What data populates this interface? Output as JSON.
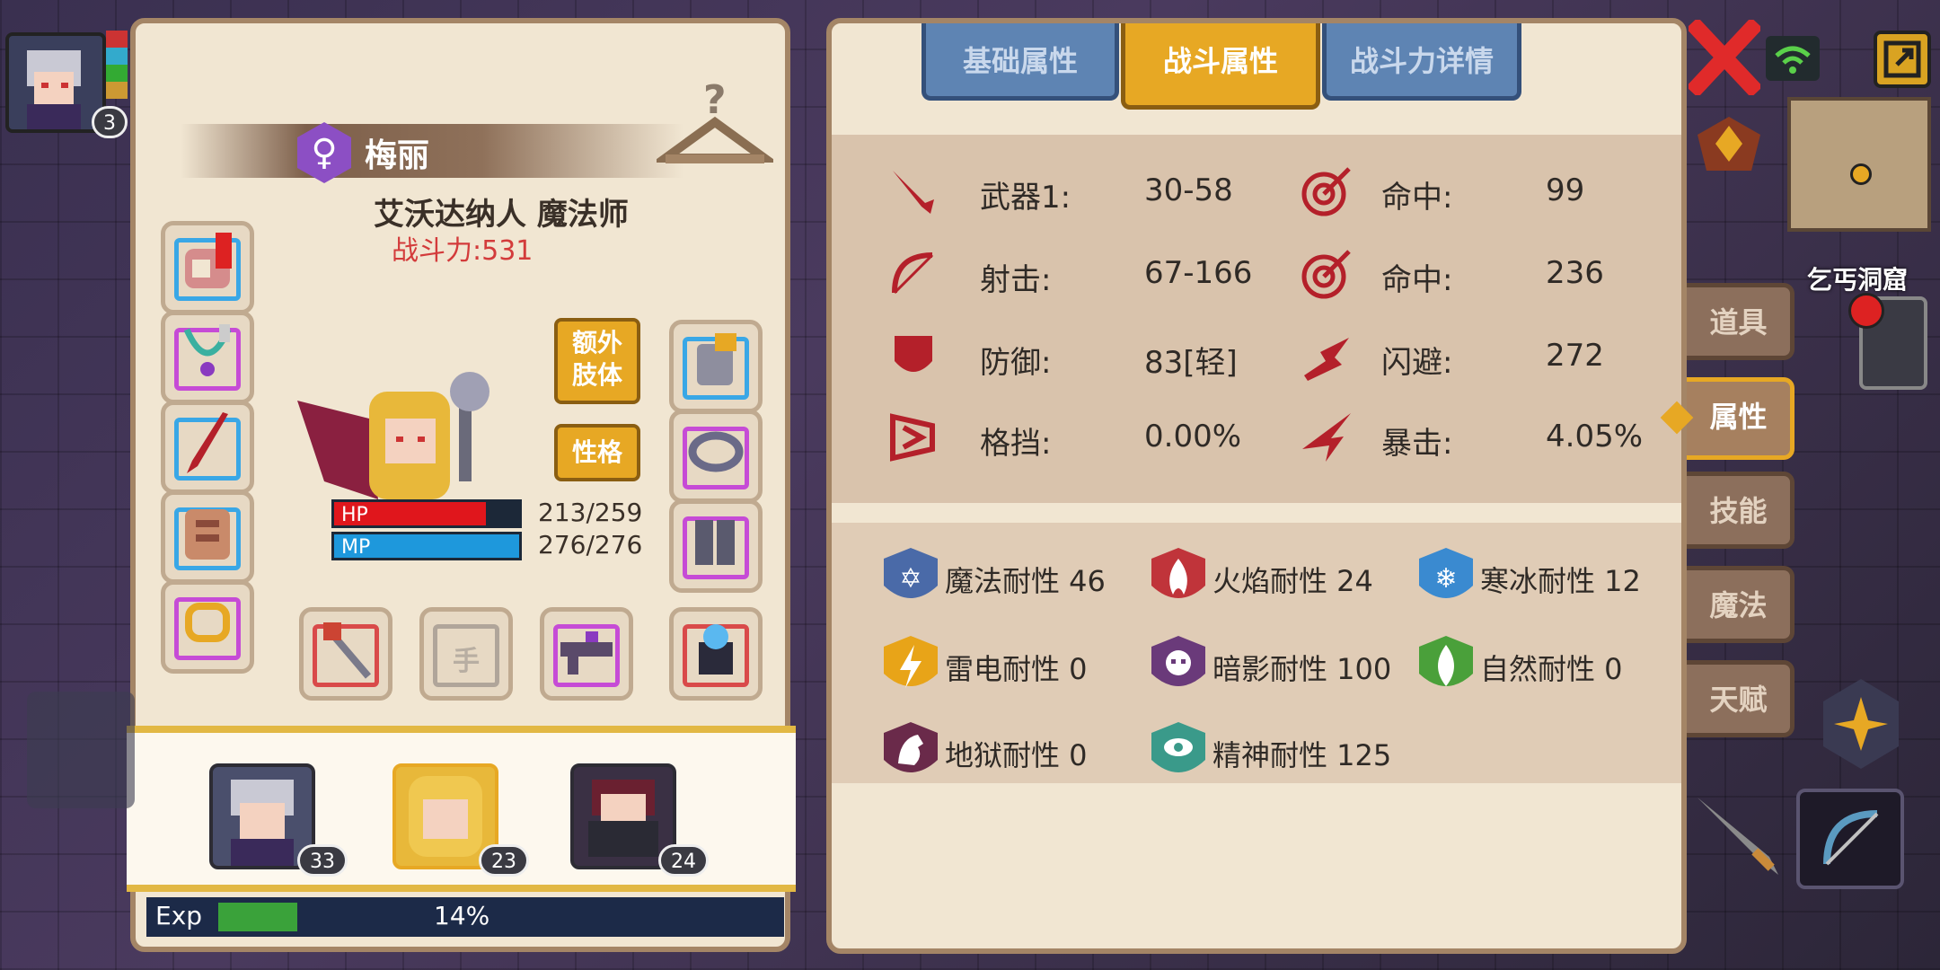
{
  "character": {
    "name": "梅丽",
    "class": "艾沃达纳人 魔法师",
    "combat_power": "战斗力:531",
    "hp_label": "HP",
    "hp_value": "213/259",
    "hp_fraction": 0.82,
    "mp_label": "MP",
    "mp_value": "276/276",
    "mp_fraction": 1.0
  },
  "buttons": {
    "extra_limbs": "额外\n肢体",
    "personality": "性格",
    "hand_slot_label": "手"
  },
  "roster": [
    {
      "level": "33"
    },
    {
      "level": "23"
    },
    {
      "level": "24"
    }
  ],
  "corner_level": "3",
  "exp": {
    "label": "Exp",
    "percent": "14%",
    "fraction": 0.14
  },
  "tabs": [
    {
      "label": "基础属性",
      "active": false
    },
    {
      "label": "战斗属性",
      "active": true
    },
    {
      "label": "战斗力详情",
      "active": false
    }
  ],
  "combat_stats": {
    "left": [
      {
        "icon": "sword-icon",
        "label": "武器1:",
        "value": "30-58"
      },
      {
        "icon": "bow-icon",
        "label": "射击:",
        "value": "67-166"
      },
      {
        "icon": "shield-icon",
        "label": "防御:",
        "value": "83[轻]"
      },
      {
        "icon": "parry-icon",
        "label": "格挡:",
        "value": "0.00%"
      }
    ],
    "right": [
      {
        "icon": "target-icon",
        "label": "命中:",
        "value": "99"
      },
      {
        "icon": "target-icon",
        "label": "命中:",
        "value": "236"
      },
      {
        "icon": "dodge-icon",
        "label": "闪避:",
        "value": "272"
      },
      {
        "icon": "crit-icon",
        "label": "暴击:",
        "value": "4.05%"
      }
    ]
  },
  "resistances": [
    {
      "icon": "magic-resist-icon",
      "text": "魔法耐性 46",
      "color": "#4a6aa8"
    },
    {
      "icon": "fire-resist-icon",
      "text": "火焰耐性 24",
      "color": "#c0343a"
    },
    {
      "icon": "ice-resist-icon",
      "text": "寒冰耐性 12",
      "color": "#3a8ad0"
    },
    {
      "icon": "lightning-resist-icon",
      "text": "雷电耐性 0",
      "color": "#e8a418"
    },
    {
      "icon": "shadow-resist-icon",
      "text": "暗影耐性 100",
      "color": "#6a3a7a"
    },
    {
      "icon": "nature-resist-icon",
      "text": "自然耐性 0",
      "color": "#4aa03a"
    },
    {
      "icon": "hell-resist-icon",
      "text": "地狱耐性 0",
      "color": "#6a2a4a"
    },
    {
      "icon": "spirit-resist-icon",
      "text": "精神耐性 125",
      "color": "#3a9a8a"
    }
  ],
  "side_menu": [
    {
      "label": "道具",
      "active": false
    },
    {
      "label": "属性",
      "active": true
    },
    {
      "label": "技能",
      "active": false
    },
    {
      "label": "魔法",
      "active": false
    },
    {
      "label": "天赋",
      "active": false
    }
  ],
  "map": {
    "location": "乞丐洞窟"
  },
  "colors": {
    "accent": "#e7a824",
    "hp": "#e0161c",
    "mp": "#1e98dc",
    "power": "#d33b3b"
  }
}
